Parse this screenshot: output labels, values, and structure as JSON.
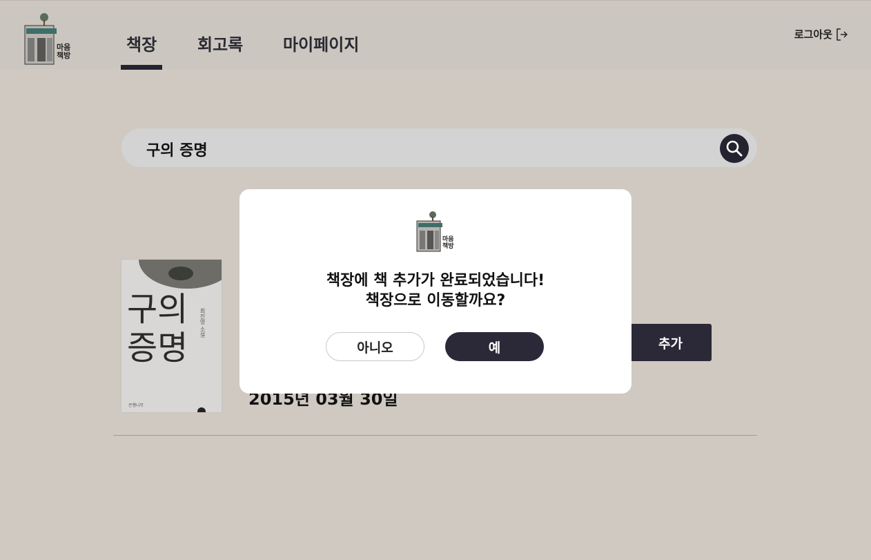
{
  "header": {
    "logo_text_line1": "마음",
    "logo_text_line2": "책방",
    "tabs": [
      {
        "label": "책장",
        "active": true
      },
      {
        "label": "회고록",
        "active": false
      },
      {
        "label": "마이페이지",
        "active": false
      }
    ],
    "logout_label": "로그아웃",
    "logout_icon": "logout-icon"
  },
  "search": {
    "value": "구의 증명",
    "icon": "search-icon"
  },
  "result": {
    "cover_title": "구의 증명",
    "cover_author": "최진영 소설",
    "cover_publisher": "은행나무",
    "date": "2015년 03월 30일",
    "add_label": "추가"
  },
  "modal": {
    "logo_text_line1": "마음",
    "logo_text_line2": "책방",
    "message_line1": "책장에 책 추가가 완료되었습니다!",
    "message_line2": "책장으로 이동할까요?",
    "no_label": "아니오",
    "yes_label": "예"
  },
  "colors": {
    "background": "#cfc9c1",
    "accent": "#2b2937"
  }
}
